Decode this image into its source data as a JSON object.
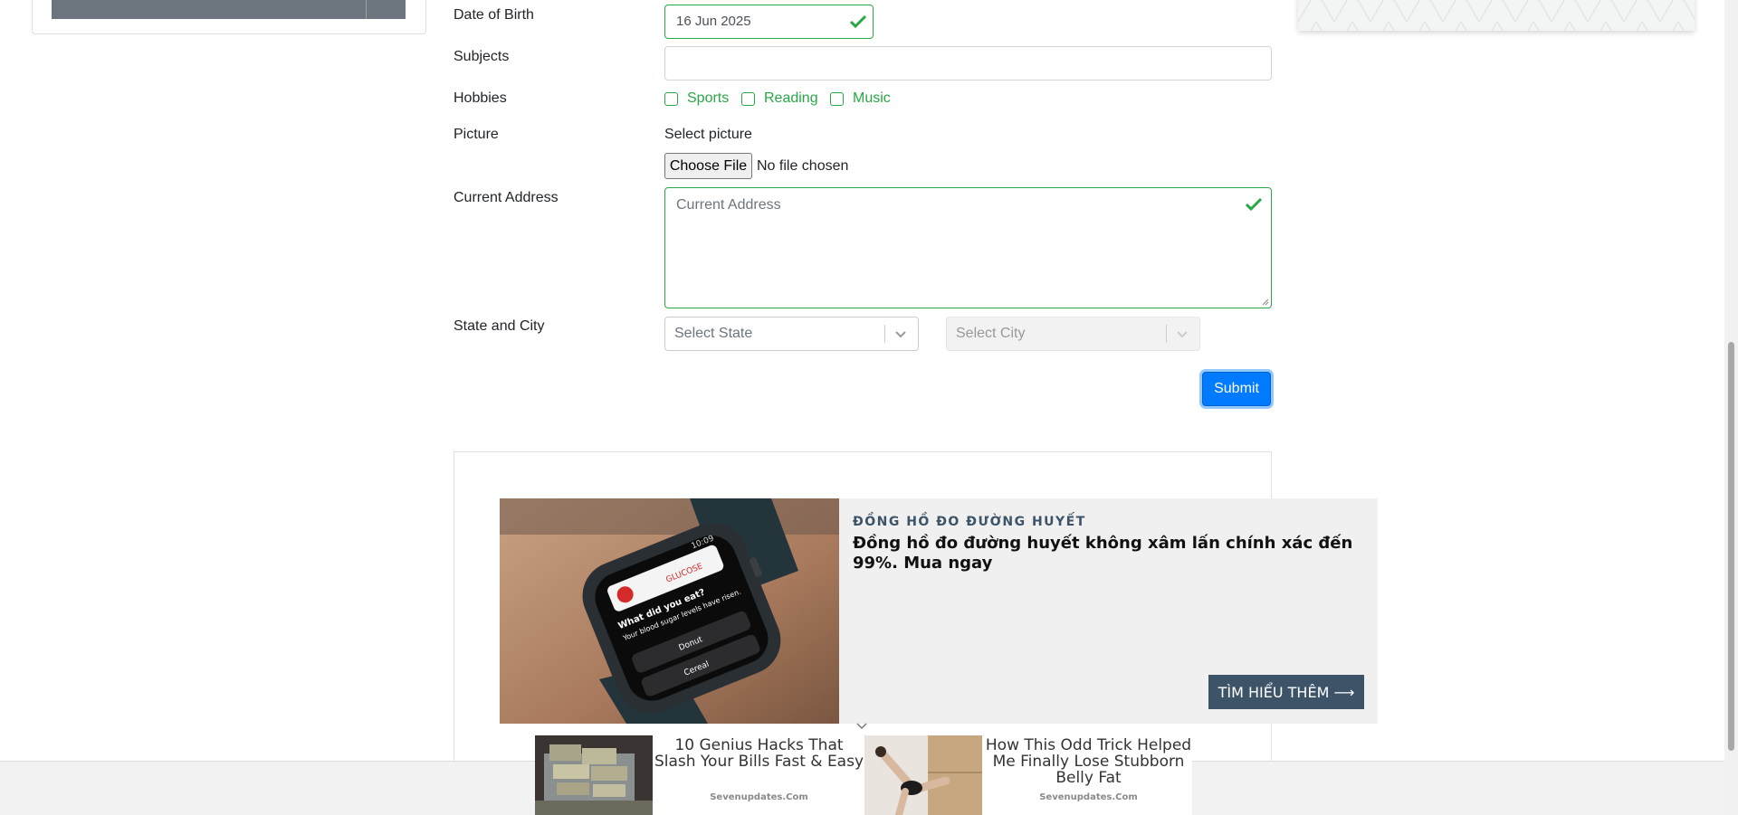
{
  "form": {
    "dob": {
      "label": "Date of Birth",
      "value": "16 Jun 2025"
    },
    "subjects": {
      "label": "Subjects",
      "value": ""
    },
    "hobbies": {
      "label": "Hobbies",
      "options": [
        {
          "label": "Sports",
          "checked": false
        },
        {
          "label": "Reading",
          "checked": false
        },
        {
          "label": "Music",
          "checked": false
        }
      ]
    },
    "picture": {
      "label": "Picture",
      "select_text": "Select picture",
      "button_label": "Choose File",
      "status": "No file chosen"
    },
    "address": {
      "label": "Current Address",
      "placeholder": "Current Address"
    },
    "state_city": {
      "label": "State and City",
      "state_placeholder": "Select State",
      "city_placeholder": "Select City"
    },
    "submit_label": "Submit"
  },
  "ad": {
    "kicker": "ĐỒNG HỒ ĐO ĐƯỜNG HUYẾT",
    "title": "Đồng hồ đo đường huyết không xâm lấn chính xác đến 99%. Mua ngay",
    "cta": "TÌM HIỂU THÊM ⟶",
    "watch_screen": {
      "time": "10:09",
      "badge": "GLUCOSE",
      "question": "What did you eat?",
      "message": "Your blood sugar levels have risen.",
      "option1": "Donut",
      "option2": "Cereal"
    }
  },
  "native_ads": [
    {
      "title": "10 Genius Hacks That Slash Your Bills Fast & Easy",
      "source": "Sevenupdates.Com"
    },
    {
      "title": "How This Odd Trick Helped Me Finally Lose Stubborn Belly Fat",
      "source": "Sevenupdates.Com"
    }
  ],
  "colors": {
    "valid": "#28a745",
    "primary": "#007bff",
    "ad_accent": "#3d5468"
  }
}
